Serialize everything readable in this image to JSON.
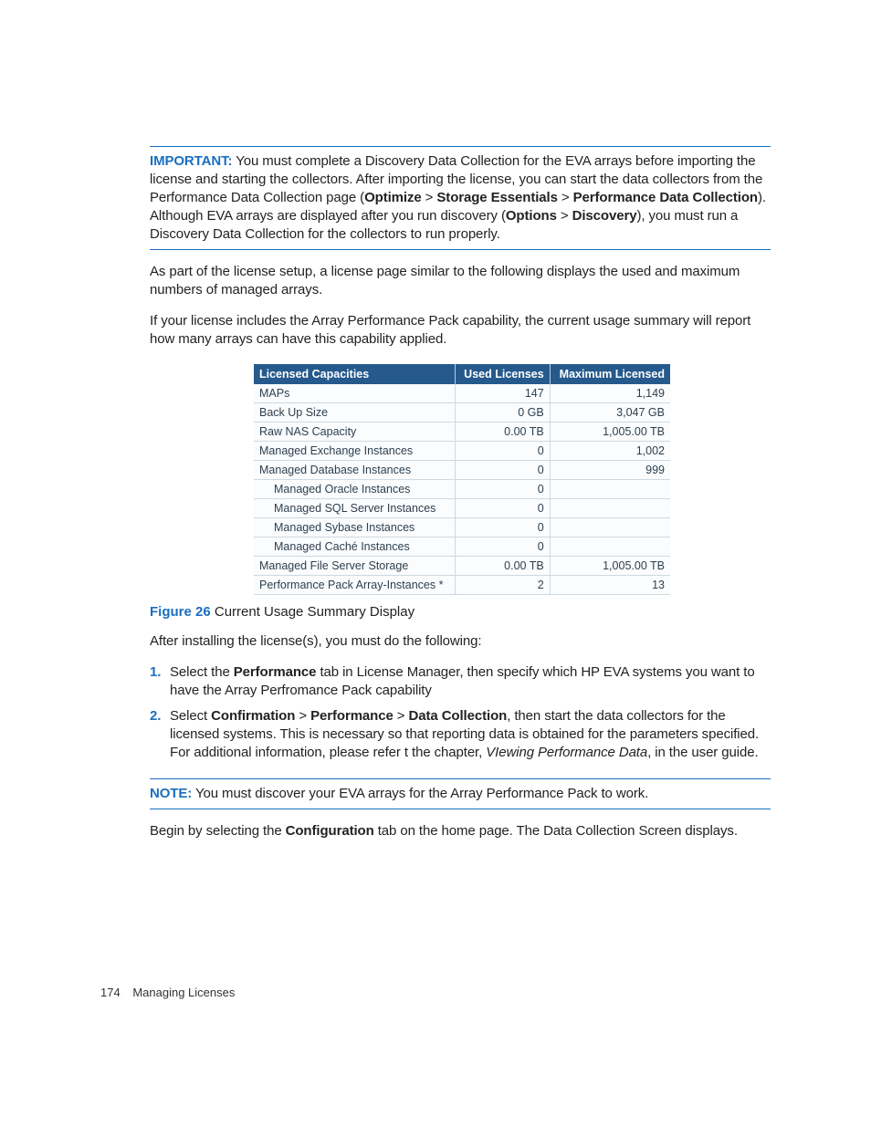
{
  "important": {
    "label": "IMPORTANT:",
    "text_1": "You must complete a Discovery Data Collection for the EVA arrays before importing the license and starting the collectors. After importing the license, you can start the data collectors from the Performance Data Collection page (",
    "b1": "Optimize",
    "gt1": " > ",
    "b2": "Storage Essentials",
    "gt2": " > ",
    "b3": "Performance Data Collection",
    "text_2": "). Although EVA arrays are displayed after you run discovery (",
    "b4": "Options",
    "gt3": " > ",
    "b5": "Discovery",
    "text_3": "), you must run a Discovery Data Collection for the collectors to run properly."
  },
  "para1": "As part of the license setup, a license page similar to the following displays the used and maximum numbers of managed arrays.",
  "para2": "If your license includes the Array Performance Pack capability, the current usage summary will report how many arrays can have this capability applied.",
  "table": {
    "headers": [
      "Licensed Capacities",
      "Used Licenses",
      "Maximum Licensed"
    ],
    "rows": [
      {
        "c0": "MAPs",
        "c1": "147",
        "c2": "1,149",
        "indent": false
      },
      {
        "c0": "Back Up Size",
        "c1": "0 GB",
        "c2": "3,047 GB",
        "indent": false
      },
      {
        "c0": "Raw NAS Capacity",
        "c1": "0.00 TB",
        "c2": "1,005.00 TB",
        "indent": false
      },
      {
        "c0": "Managed Exchange Instances",
        "c1": "0",
        "c2": "1,002",
        "indent": false
      },
      {
        "c0": "Managed Database Instances",
        "c1": "0",
        "c2": "999",
        "indent": false
      },
      {
        "c0": "Managed Oracle Instances",
        "c1": "0",
        "c2": "",
        "indent": true
      },
      {
        "c0": "Managed SQL Server Instances",
        "c1": "0",
        "c2": "",
        "indent": true
      },
      {
        "c0": "Managed Sybase Instances",
        "c1": "0",
        "c2": "",
        "indent": true
      },
      {
        "c0": "Managed Caché Instances",
        "c1": "0",
        "c2": "",
        "indent": true
      },
      {
        "c0": "Managed File Server Storage",
        "c1": "0.00 TB",
        "c2": "1,005.00 TB",
        "indent": false
      },
      {
        "c0": "Performance Pack Array-Instances *",
        "c1": "2",
        "c2": "13",
        "indent": false
      }
    ]
  },
  "figure": {
    "label": "Figure 26",
    "caption": "Current Usage Summary Display"
  },
  "para3": "After installing the license(s), you must do the following:",
  "steps": {
    "s1_a": "Select the ",
    "s1_b": "Performance",
    "s1_c": " tab in License Manager, then specify which HP EVA systems you want to have the Array Perfromance Pack capability",
    "s2_a": "Select ",
    "s2_b1": "Confirmation",
    "s2_gt1": " > ",
    "s2_b2": "Performance",
    "s2_gt2": " > ",
    "s2_b3": "Data Collection",
    "s2_c": ", then start the data collectors for the licensed systems. This is necessary so that reporting data is obtained for the parameters specified. For additional information, please refer t the chapter, ",
    "s2_i": "VIewing Performance Data",
    "s2_d": ", in the user guide."
  },
  "note": {
    "label": "NOTE:",
    "text": "You must discover your EVA arrays for the Array Performance Pack to work."
  },
  "para4_a": "Begin by selecting the ",
  "para4_b": "Configuration",
  "para4_c": " tab on the home page. The Data Collection Screen displays.",
  "footer": {
    "page": "174",
    "section": "Managing Licenses"
  }
}
